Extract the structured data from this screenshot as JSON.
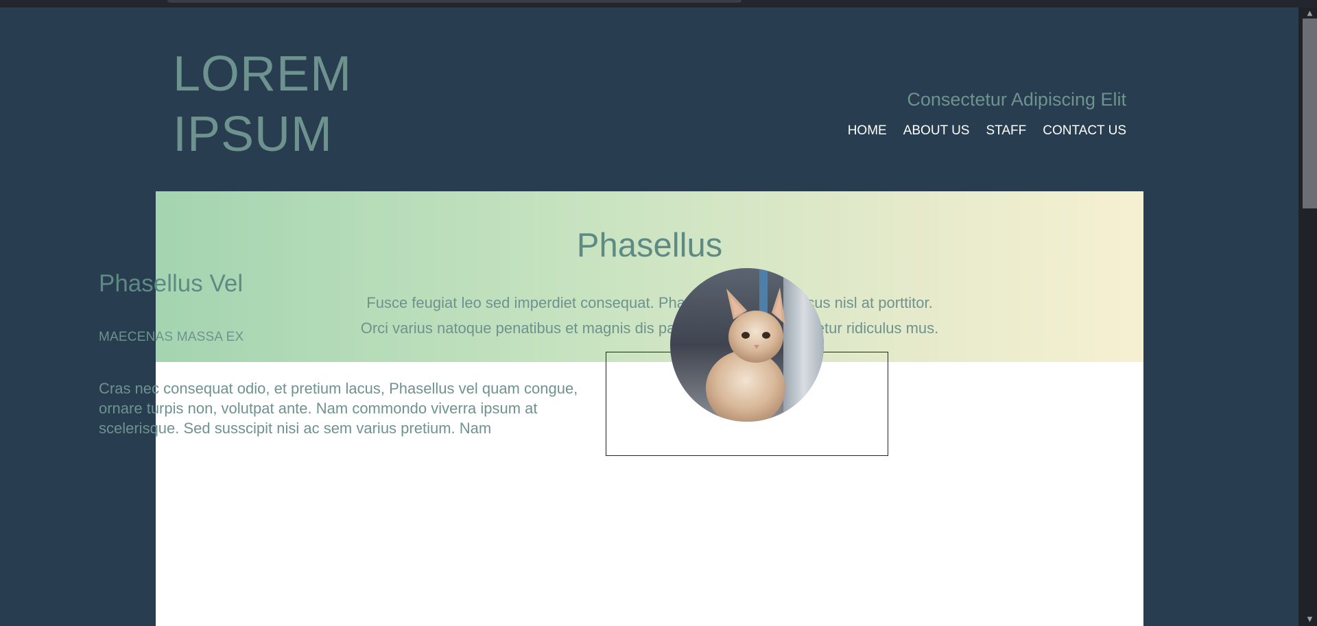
{
  "site": {
    "logo_line1": "LOREM",
    "logo_line2": "IPSUM",
    "tagline": "Consectetur Adipiscing Elit"
  },
  "nav": {
    "items": [
      "HOME",
      "ABOUT US",
      "STAFF",
      "CONTACT US"
    ]
  },
  "hero": {
    "title": "Phasellus",
    "line1": "Fusce feugiat leo sed imperdiet consequat. Phasellus cursus rhoncus nisl at porttitor.",
    "line2": "Orci varius natoque penatibus et magnis dis parturient montes, nascetur ridiculus mus."
  },
  "section": {
    "title": "Phasellus Vel",
    "subtitle": "MAECENAS MASSA EX",
    "body": "Cras nec consequat odio, et pretium lacus, Phasellus vel quam congue, ornare turpis non, volutpat ante. Nam commondo viverra ipsum at scelerisque. Sed susscipit nisi ac sem varius pretium. Nam"
  },
  "colors": {
    "page_bg": "#283d50",
    "accent_text": "#6e938e",
    "hero_gradient_start": "#a4d4b0",
    "hero_gradient_end": "#f6f0d2"
  },
  "icons": {
    "scroll_up": "chevron-up-icon",
    "scroll_down": "chevron-down-icon",
    "avatar": "kitten-photo"
  }
}
